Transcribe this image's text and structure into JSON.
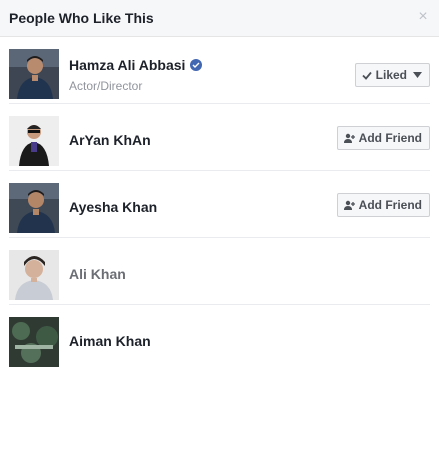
{
  "header": {
    "title": "People Who Like This",
    "close_icon": "×"
  },
  "people": [
    {
      "name": "Hamza Ali Abbasi",
      "subtitle": "Actor/Director",
      "verified": true,
      "button": "Liked",
      "button_icon": "check-icon"
    },
    {
      "name": "ArYan KhAn",
      "subtitle": "",
      "verified": false,
      "button": "Add Friend",
      "button_icon": "add-friend-icon"
    },
    {
      "name": "Ayesha Khan",
      "subtitle": "",
      "verified": false,
      "button": "Add Friend",
      "button_icon": "add-friend-icon"
    },
    {
      "name": "Ali Khan",
      "subtitle": "",
      "verified": false,
      "button": "",
      "button_icon": ""
    },
    {
      "name": "Aiman Khan",
      "subtitle": "",
      "verified": false,
      "button": "",
      "button_icon": ""
    }
  ],
  "colors": {
    "verified_badge": "#4267b2",
    "header_bg": "#f6f7f9",
    "divider": "#e9ebee"
  }
}
